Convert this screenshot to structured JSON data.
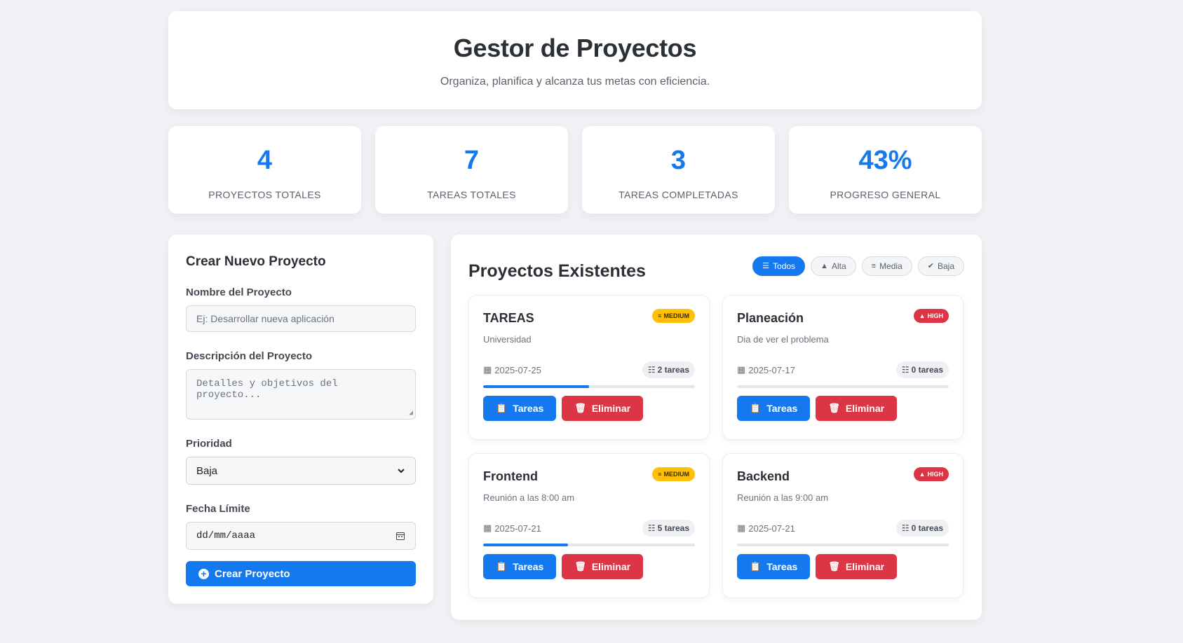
{
  "header": {
    "title": "Gestor de Proyectos",
    "subtitle": "Organiza, planifica y alcanza tus metas con eficiencia."
  },
  "stats": [
    {
      "value": "4",
      "label": "PROYECTOS TOTALES"
    },
    {
      "value": "7",
      "label": "TAREAS TOTALES"
    },
    {
      "value": "3",
      "label": "TAREAS COMPLETADAS"
    },
    {
      "value": "43%",
      "label": "PROGRESO GENERAL"
    }
  ],
  "form": {
    "title": "Crear Nuevo Proyecto",
    "name_label": "Nombre del Proyecto",
    "name_placeholder": "Ej: Desarrollar nueva aplicación",
    "desc_label": "Descripción del Proyecto",
    "desc_placeholder": "Detalles y objetivos del proyecto...",
    "priority_label": "Prioridad",
    "priority_value": "Baja",
    "date_label": "Fecha Límite",
    "date_placeholder": "dd/mm/aaaa",
    "submit_label": "Crear Proyecto"
  },
  "projects_panel": {
    "title": "Proyectos Existentes",
    "filters": [
      {
        "label": "Todos",
        "icon": "list-icon",
        "active": true
      },
      {
        "label": "Alta",
        "icon": "warning-icon",
        "active": false
      },
      {
        "label": "Media",
        "icon": "sliders-icon",
        "active": false
      },
      {
        "label": "Baja",
        "icon": "check-circle-icon",
        "active": false
      }
    ]
  },
  "projects": [
    {
      "title": "TAREAS",
      "description": "Universidad",
      "priority": "MEDIUM",
      "date": "2025-07-25",
      "tasks": "2 tareas",
      "progress": 0.5,
      "tasks_button": "Tareas",
      "delete_button": "Eliminar"
    },
    {
      "title": "Planeación",
      "description": "Dia de ver el problema",
      "priority": "HIGH",
      "date": "2025-07-17",
      "tasks": "0 tareas",
      "progress": 0,
      "tasks_button": "Tareas",
      "delete_button": "Eliminar"
    },
    {
      "title": "Frontend",
      "description": "Reunión a las 8:00 am",
      "priority": "MEDIUM",
      "date": "2025-07-21",
      "tasks": "5 tareas",
      "progress": 0.4,
      "tasks_button": "Tareas",
      "delete_button": "Eliminar"
    },
    {
      "title": "Backend",
      "description": "Reunión a las 9:00 am",
      "priority": "HIGH",
      "date": "2025-07-21",
      "tasks": "0 tareas",
      "progress": 0,
      "tasks_button": "Tareas",
      "delete_button": "Eliminar"
    }
  ],
  "colors": {
    "accent": "#1479ee",
    "danger": "#dc3545",
    "warning": "#ffc107",
    "background": "#f1f2f5"
  }
}
